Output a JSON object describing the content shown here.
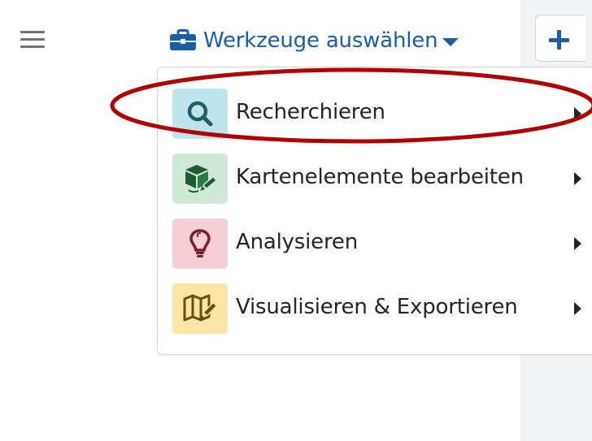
{
  "toolbar": {
    "hamburger_icon": "hamburger-menu-icon",
    "tools_icon": "briefcase-icon",
    "tools_label": "Werkzeuge auswählen",
    "add_icon": "plus-icon"
  },
  "menu": {
    "items": [
      {
        "label": "Recherchieren",
        "icon": "search-icon",
        "tile_color": "#bfe5ec",
        "icon_color": "#1f5f68"
      },
      {
        "label": "Kartenelemente bearbeiten",
        "icon": "edit-map-elements-icon",
        "tile_color": "#cfe9d6",
        "icon_color": "#1e5a33"
      },
      {
        "label": "Analysieren",
        "icon": "lightbulb-icon",
        "tile_color": "#f4cfd3",
        "icon_color": "#7a1f2b"
      },
      {
        "label": "Visualisieren & Exportieren",
        "icon": "map-pencil-icon",
        "tile_color": "#fbe6a8",
        "icon_color": "#6b4f0c"
      }
    ]
  },
  "highlight": {
    "color": "#b00000",
    "target": "Recherchieren"
  }
}
